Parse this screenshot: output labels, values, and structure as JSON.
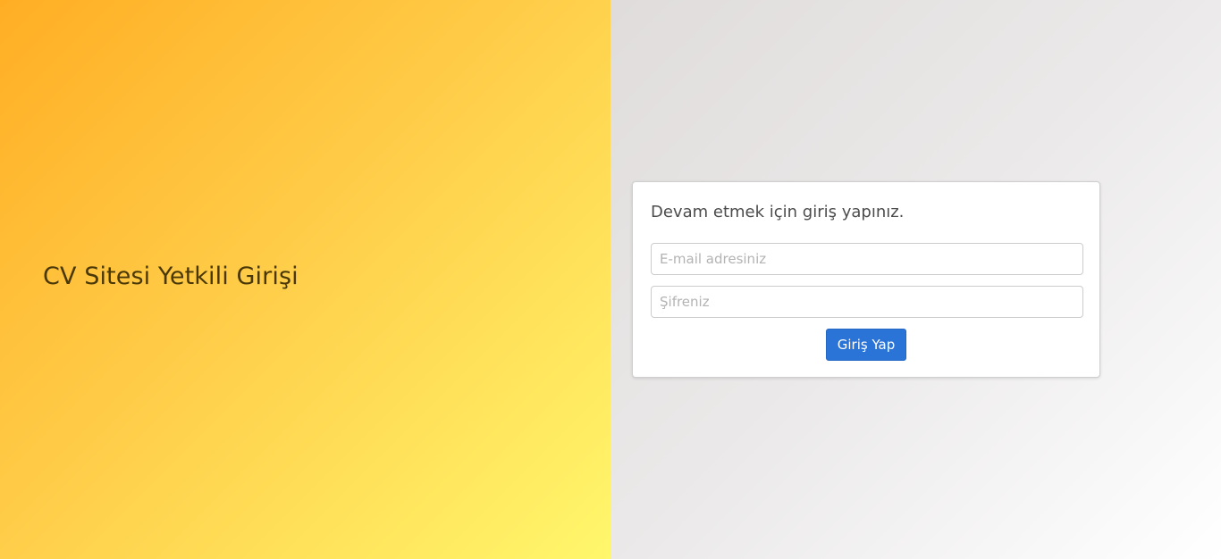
{
  "left_panel": {
    "title": "CV Sitesi Yetkili Girişi"
  },
  "login_card": {
    "heading": "Devam etmek için giriş yapınız.",
    "email_placeholder": "E-mail adresiniz",
    "email_value": "",
    "password_placeholder": "Şifreniz",
    "password_value": "",
    "submit_label": "Giriş Yap"
  },
  "colors": {
    "left_gradient_start": "#ffae24",
    "left_gradient_end": "#fff76c",
    "right_gradient_start": "#e0dcdc",
    "right_gradient_end": "#ffffff",
    "button": "#2a74d8",
    "title_text": "#4a3808"
  }
}
